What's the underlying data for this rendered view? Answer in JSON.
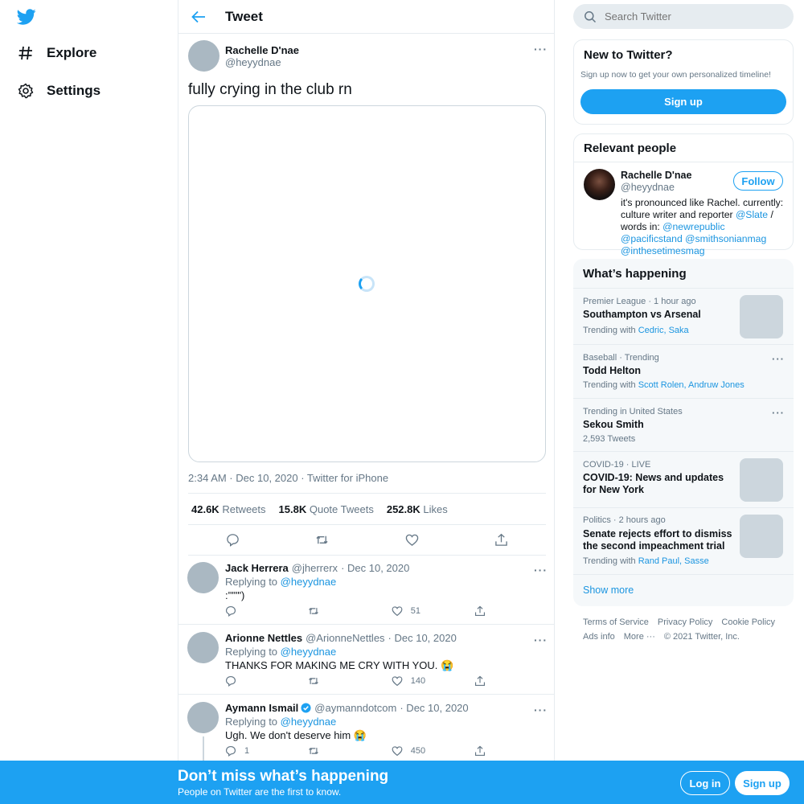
{
  "colors": {
    "accent": "#1da1f2",
    "link": "#1b95e0",
    "muted": "#657786",
    "border": "#e6ecf0"
  },
  "nav": {
    "logo": "twitter-bird-icon",
    "items": [
      {
        "label": "Explore",
        "icon": "hashtag-icon"
      },
      {
        "label": "Settings",
        "icon": "gear-icon"
      }
    ]
  },
  "header": {
    "title": "Tweet"
  },
  "tweet": {
    "name": "Rachelle D'nae",
    "handle": "@heyydnae",
    "text": "fully crying in the club rn",
    "meta": "2:34 AM · Dec 10, 2020 · Twitter for iPhone",
    "stats": [
      {
        "value": "42.6K",
        "label": "Retweets"
      },
      {
        "value": "15.8K",
        "label": "Quote Tweets"
      },
      {
        "value": "252.8K",
        "label": "Likes"
      }
    ]
  },
  "replies": [
    {
      "name": "Jack Herrera",
      "handle": "@jherrerx",
      "date": "· Dec 10, 2020",
      "replying_prefix": "Replying to",
      "replying_to": "@heyydnae",
      "text": ":'\"\"\")",
      "reply_count": "",
      "like_count": "51"
    },
    {
      "name": "Arionne Nettles",
      "handle": "@ArionneNettles",
      "date": "· Dec 10, 2020",
      "replying_prefix": "Replying to",
      "replying_to": "@heyydnae",
      "text": "THANKS FOR MAKING ME CRY WITH YOU. 😭",
      "reply_count": "",
      "like_count": "140"
    },
    {
      "name": "Aymann Ismail",
      "handle": "@aymanndotcom",
      "date": "· Dec 10, 2020",
      "replying_prefix": "Replying to",
      "replying_to": "@heyydnae",
      "text": "Ugh. We don't deserve him 😭",
      "reply_count": "1",
      "like_count": "450"
    }
  ],
  "search": {
    "placeholder": "Search Twitter"
  },
  "new_to_twitter": {
    "title": "New to Twitter?",
    "subtitle": "Sign up now to get your own personalized timeline!",
    "button": "Sign up"
  },
  "relevant": {
    "title": "Relevant people",
    "name": "Rachelle D'nae",
    "handle": "@heyydnae",
    "follow": "Follow",
    "bio_1": "it's pronounced like Rachel. currently: culture writer and reporter ",
    "bio_link_1": "@Slate",
    "bio_2": " / words in: ",
    "bio_link_2": "@newrepublic",
    "bio_link_3": "@pacificstand",
    "bio_link_4": "@smithsonianmag",
    "bio_link_5": "@inthesetimesmag"
  },
  "happening": {
    "title": "What’s happening",
    "trends": [
      {
        "meta": "Premier League · 1 hour ago",
        "title": "Southampton vs Arsenal",
        "sub_prefix": "Trending with",
        "links": "Cedric, Saka"
      },
      {
        "meta": "Baseball · Trending",
        "title": "Todd Helton",
        "sub_prefix": "Trending with",
        "links": "Scott Rolen, Andruw Jones"
      },
      {
        "meta": "Trending in United States",
        "title": "Sekou Smith",
        "sub": "2,593 Tweets"
      },
      {
        "meta": "COVID-19 · LIVE",
        "title": "COVID-19: News and updates for New York"
      },
      {
        "meta": "Politics · 2 hours ago",
        "title": "Senate rejects effort to dismiss the second impeachment trial",
        "sub_prefix": "Trending with",
        "links": "Rand Paul, Sasse"
      }
    ],
    "show_more": "Show more"
  },
  "footer": {
    "links": [
      "Terms of Service",
      "Privacy Policy",
      "Cookie Policy",
      "Ads info",
      "More ···"
    ],
    "copyright": "© 2021 Twitter, Inc."
  },
  "bottom_bar": {
    "title": "Don’t miss what’s happening",
    "subtitle": "People on Twitter are the first to know.",
    "login": "Log in",
    "signup": "Sign up"
  }
}
